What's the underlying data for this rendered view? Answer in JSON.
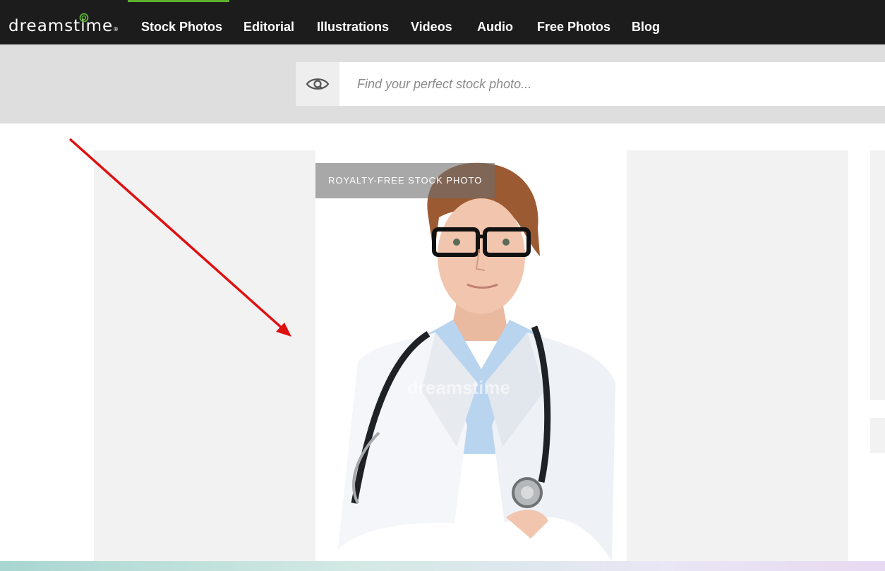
{
  "header": {
    "logo_text": "dreamstime",
    "logo_reg": "®",
    "nav": [
      {
        "label": "Stock Photos",
        "active": true
      },
      {
        "label": "Editorial",
        "active": false
      },
      {
        "label": "Illustrations",
        "active": false
      },
      {
        "label": "Videos",
        "active": false
      },
      {
        "label": "Audio",
        "active": false
      },
      {
        "label": "Free Photos",
        "active": false
      },
      {
        "label": "Blog",
        "active": false
      }
    ],
    "accent_color": "#5db12f"
  },
  "search": {
    "placeholder": "Find your perfect stock photo...",
    "value": "",
    "icon": "eye-icon"
  },
  "main": {
    "badge_text": "ROYALTY-FREE STOCK PHOTO",
    "photo_watermark": "dreamstime"
  },
  "annotation": {
    "arrow_color": "#e01010"
  }
}
